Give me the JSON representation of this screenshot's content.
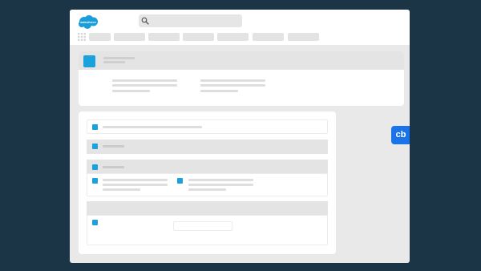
{
  "header": {
    "logo_text": "salesforce",
    "search": {
      "placeholder": ""
    }
  },
  "widget": {
    "label": "cb",
    "color": "#1a73e8"
  },
  "colors": {
    "background": "#1b3547",
    "window": "#e9e9ea",
    "accent": "#1ba1dc",
    "placeholder": "#dedede"
  }
}
